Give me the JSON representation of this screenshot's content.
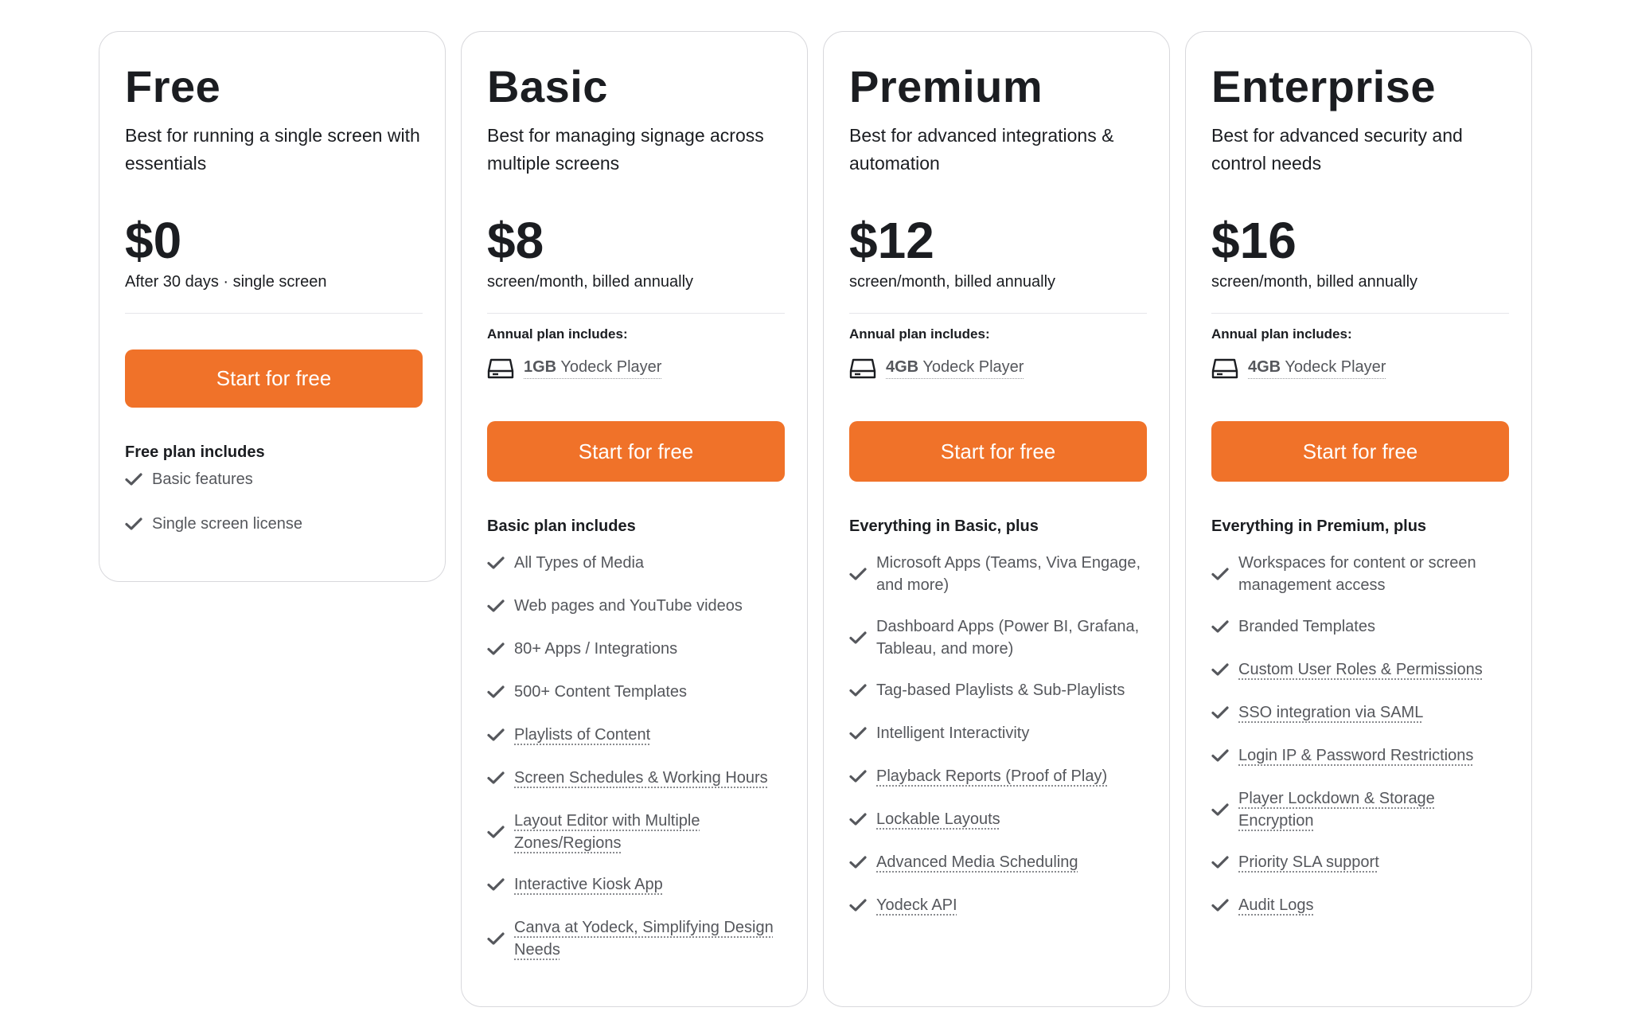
{
  "plans": [
    {
      "name": "Free",
      "description": "Best for running a single screen with essentials",
      "price": "$0",
      "price_note": "After 30 days · single screen",
      "cta": "Start for free",
      "includes_title": "Free plan includes",
      "features": [
        "Basic features",
        "Single screen license"
      ]
    },
    {
      "name": "Basic",
      "description": "Best for managing signage across multiple screens",
      "price": "$8",
      "price_note": "screen/month, billed annually",
      "annual_label": "Annual plan includes:",
      "player_size": "1GB",
      "player_label": "Yodeck Player",
      "cta": "Start for free",
      "includes_title": "Basic plan includes",
      "features": [
        "All Types of Media",
        "Web pages and YouTube videos",
        "80+ Apps / Integrations",
        "500+ Content Templates",
        "Playlists of Content",
        "Screen Schedules & Working Hours",
        "Layout Editor with Multiple Zones/Regions",
        "Interactive Kiosk App",
        "Canva at Yodeck, Simplifying Design Needs"
      ]
    },
    {
      "name": "Premium",
      "description": "Best for advanced integrations & automation",
      "price": "$12",
      "price_note": "screen/month, billed annually",
      "annual_label": "Annual plan includes:",
      "player_size": "4GB",
      "player_label": "Yodeck Player",
      "cta": "Start for free",
      "includes_title": "Everything in Basic, plus",
      "features": [
        "Microsoft Apps (Teams, Viva Engage, and more)",
        "Dashboard Apps (Power BI, Grafana, Tableau, and more)",
        "Tag-based Playlists & Sub-Playlists",
        "Intelligent Interactivity",
        "Playback Reports (Proof of Play)",
        "Lockable Layouts",
        "Advanced Media Scheduling",
        "Yodeck API"
      ]
    },
    {
      "name": "Enterprise",
      "description": "Best for advanced security and control needs",
      "price": "$16",
      "price_note": "screen/month, billed annually",
      "annual_label": "Annual plan includes:",
      "player_size": "4GB",
      "player_label": "Yodeck Player",
      "cta": "Start for free",
      "includes_title": "Everything in Premium, plus",
      "features": [
        "Workspaces for content or screen management access",
        "Branded Templates",
        "Custom User Roles & Permissions",
        "SSO integration via SAML",
        "Login IP & Password Restrictions",
        "Player Lockdown & Storage Encryption",
        "Priority SLA support",
        "Audit Logs"
      ]
    }
  ],
  "colors": {
    "accent": "#f07229",
    "text": "#1b1d21",
    "muted": "#55575c",
    "border": "#d8d8dc"
  },
  "icons": {
    "check": "check-icon",
    "player": "hard-drive-icon"
  }
}
